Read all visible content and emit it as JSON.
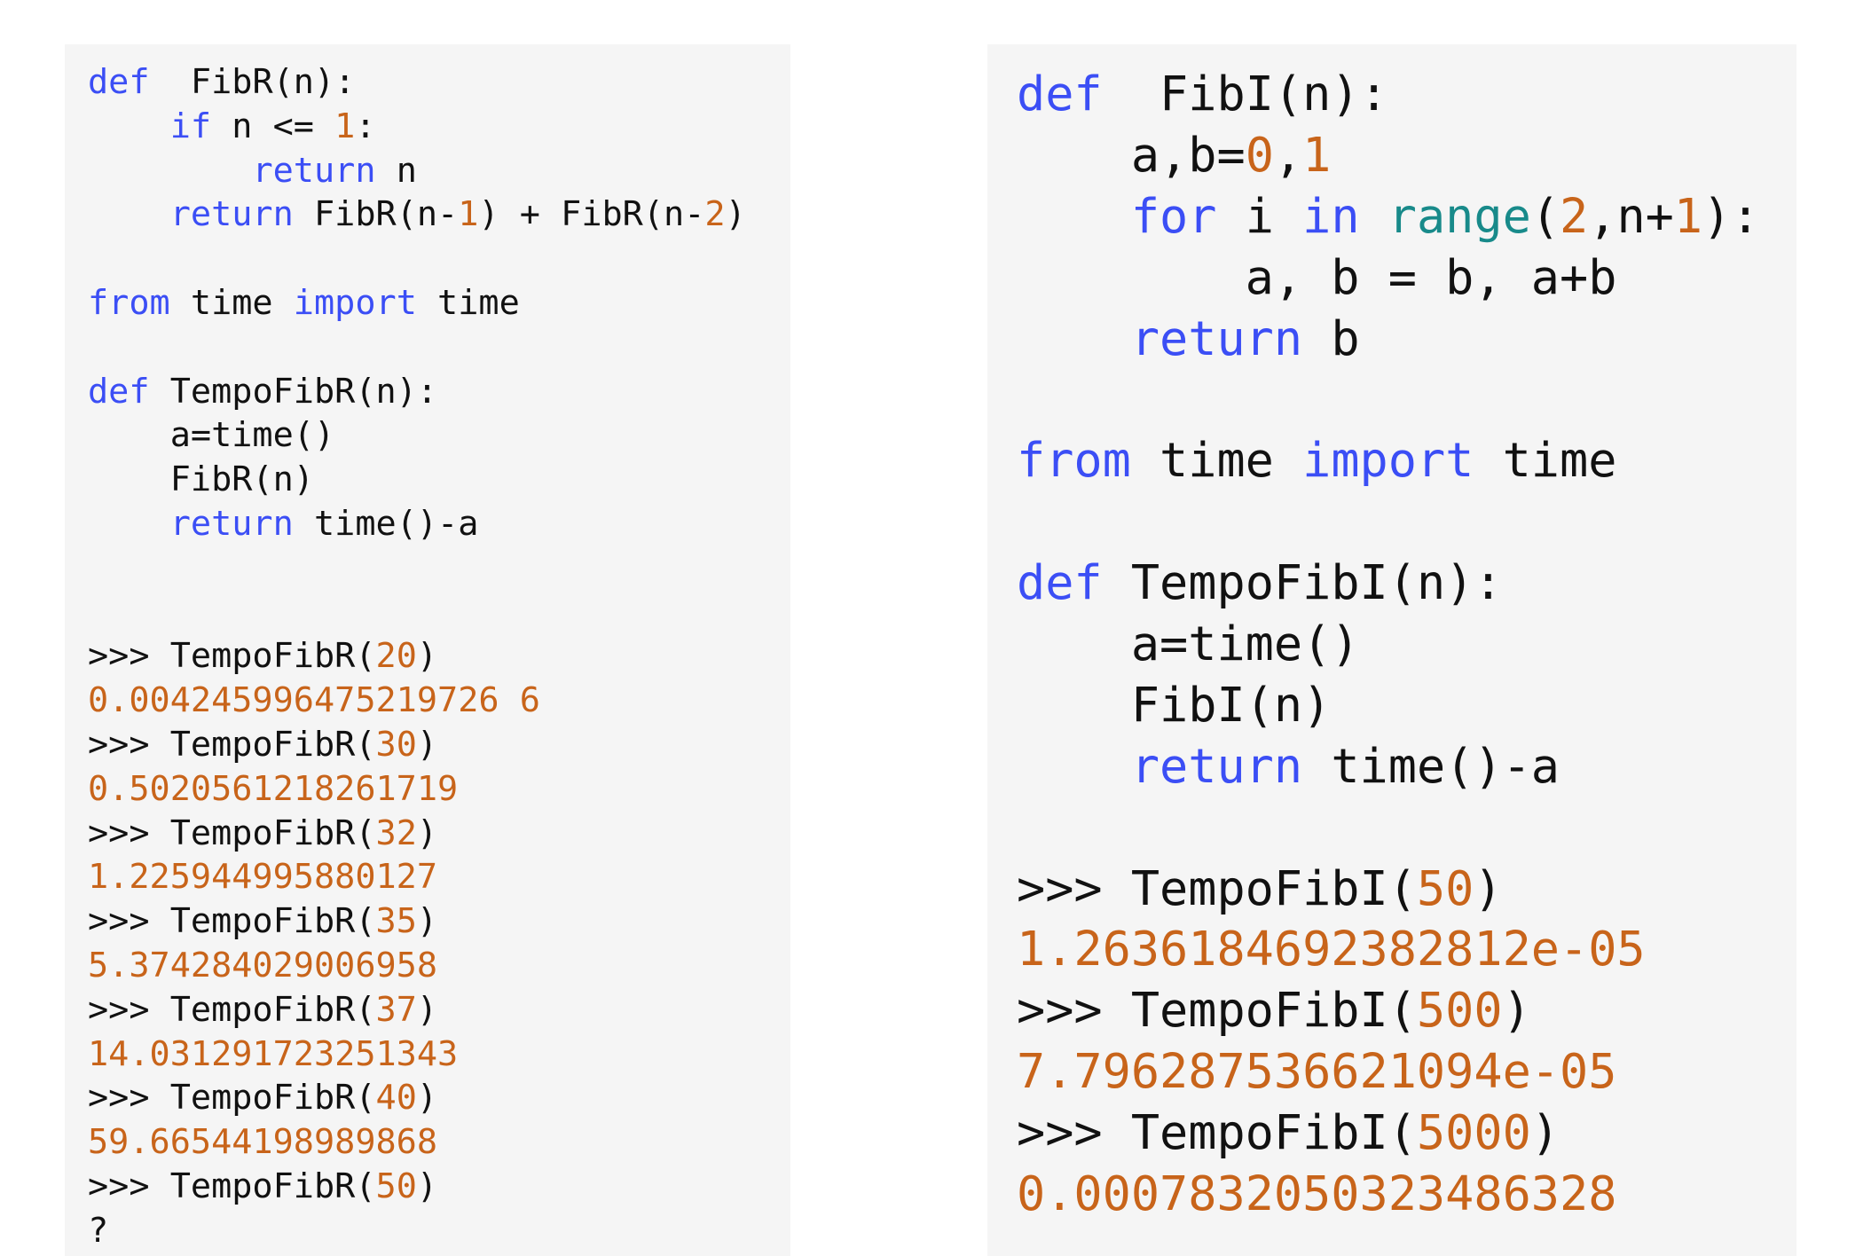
{
  "colors": {
    "background": "#ffffff",
    "panel": "#f5f5f5",
    "keyword": "#3b4ef5",
    "number": "#c8641a",
    "builtin": "#188a8a",
    "text": "#111111"
  },
  "left_panel": {
    "lines": [
      [
        [
          "kw",
          "def"
        ],
        [
          "plain",
          "  FibR(n):"
        ]
      ],
      [
        [
          "plain",
          "    "
        ],
        [
          "kw",
          "if"
        ],
        [
          "plain",
          " n <= "
        ],
        [
          "num",
          "1"
        ],
        [
          "plain",
          ":"
        ]
      ],
      [
        [
          "plain",
          "        "
        ],
        [
          "kw",
          "return"
        ],
        [
          "plain",
          " n"
        ]
      ],
      [
        [
          "plain",
          "    "
        ],
        [
          "kw",
          "return"
        ],
        [
          "plain",
          " FibR(n-"
        ],
        [
          "num",
          "1"
        ],
        [
          "plain",
          ") + FibR(n-"
        ],
        [
          "num",
          "2"
        ],
        [
          "plain",
          ")"
        ]
      ],
      [],
      [
        [
          "kw",
          "from"
        ],
        [
          "plain",
          " time "
        ],
        [
          "kw",
          "import"
        ],
        [
          "plain",
          " time"
        ]
      ],
      [],
      [
        [
          "kw",
          "def"
        ],
        [
          "plain",
          " TempoFibR(n):"
        ]
      ],
      [
        [
          "plain",
          "    a=time()"
        ]
      ],
      [
        [
          "plain",
          "    FibR(n)"
        ]
      ],
      [
        [
          "plain",
          "    "
        ],
        [
          "kw",
          "return"
        ],
        [
          "plain",
          " time()-a"
        ]
      ],
      [],
      [],
      [
        [
          "plain",
          ">>> TempoFibR("
        ],
        [
          "num",
          "20"
        ],
        [
          "plain",
          ")"
        ]
      ],
      [
        [
          "out",
          "0.004245996475219726 6"
        ]
      ],
      [
        [
          "plain",
          ">>> TempoFibR("
        ],
        [
          "num",
          "30"
        ],
        [
          "plain",
          ")"
        ]
      ],
      [
        [
          "out",
          "0.5020561218261719"
        ]
      ],
      [
        [
          "plain",
          ">>> TempoFibR("
        ],
        [
          "num",
          "32"
        ],
        [
          "plain",
          ")"
        ]
      ],
      [
        [
          "out",
          "1.225944995880127"
        ]
      ],
      [
        [
          "plain",
          ">>> TempoFibR("
        ],
        [
          "num",
          "35"
        ],
        [
          "plain",
          ")"
        ]
      ],
      [
        [
          "out",
          "5.374284029006958"
        ]
      ],
      [
        [
          "plain",
          ">>> TempoFibR("
        ],
        [
          "num",
          "37"
        ],
        [
          "plain",
          ")"
        ]
      ],
      [
        [
          "out",
          "14.031291723251343"
        ]
      ],
      [
        [
          "plain",
          ">>> TempoFibR("
        ],
        [
          "num",
          "40"
        ],
        [
          "plain",
          ")"
        ]
      ],
      [
        [
          "out",
          "59.66544198989868"
        ]
      ],
      [
        [
          "plain",
          ">>> TempoFibR("
        ],
        [
          "num",
          "50"
        ],
        [
          "plain",
          ")"
        ]
      ],
      [
        [
          "plain",
          "?"
        ]
      ]
    ]
  },
  "right_panel": {
    "lines": [
      [
        [
          "kw",
          "def"
        ],
        [
          "plain",
          "  FibI(n):"
        ]
      ],
      [
        [
          "plain",
          "    a,b="
        ],
        [
          "num",
          "0"
        ],
        [
          "plain",
          ","
        ],
        [
          "num",
          "1"
        ]
      ],
      [
        [
          "plain",
          "    "
        ],
        [
          "kw",
          "for"
        ],
        [
          "plain",
          " i "
        ],
        [
          "kw",
          "in"
        ],
        [
          "plain",
          " "
        ],
        [
          "bi",
          "range"
        ],
        [
          "plain",
          "("
        ],
        [
          "num",
          "2"
        ],
        [
          "plain",
          ",n+"
        ],
        [
          "num",
          "1"
        ],
        [
          "plain",
          "):"
        ]
      ],
      [
        [
          "plain",
          "        a, b = b, a+b"
        ]
      ],
      [
        [
          "plain",
          "    "
        ],
        [
          "kw",
          "return"
        ],
        [
          "plain",
          " b"
        ]
      ],
      [],
      [
        [
          "kw",
          "from"
        ],
        [
          "plain",
          " time "
        ],
        [
          "kw",
          "import"
        ],
        [
          "plain",
          " time"
        ]
      ],
      [],
      [
        [
          "kw",
          "def"
        ],
        [
          "plain",
          " TempoFibI(n):"
        ]
      ],
      [
        [
          "plain",
          "    a=time()"
        ]
      ],
      [
        [
          "plain",
          "    FibI(n)"
        ]
      ],
      [
        [
          "plain",
          "    "
        ],
        [
          "kw",
          "return"
        ],
        [
          "plain",
          " time()-a"
        ]
      ],
      [],
      [
        [
          "plain",
          ">>> TempoFibI("
        ],
        [
          "num",
          "50"
        ],
        [
          "plain",
          ")"
        ]
      ],
      [
        [
          "out",
          "1.2636184692382812e-05"
        ]
      ],
      [
        [
          "plain",
          ">>> TempoFibI("
        ],
        [
          "num",
          "500"
        ],
        [
          "plain",
          ")"
        ]
      ],
      [
        [
          "out",
          "7.796287536621094e-05"
        ]
      ],
      [
        [
          "plain",
          ">>> TempoFibI("
        ],
        [
          "num",
          "5000"
        ],
        [
          "plain",
          ")"
        ]
      ],
      [
        [
          "out",
          "0.0007832050323486328"
        ]
      ]
    ]
  }
}
